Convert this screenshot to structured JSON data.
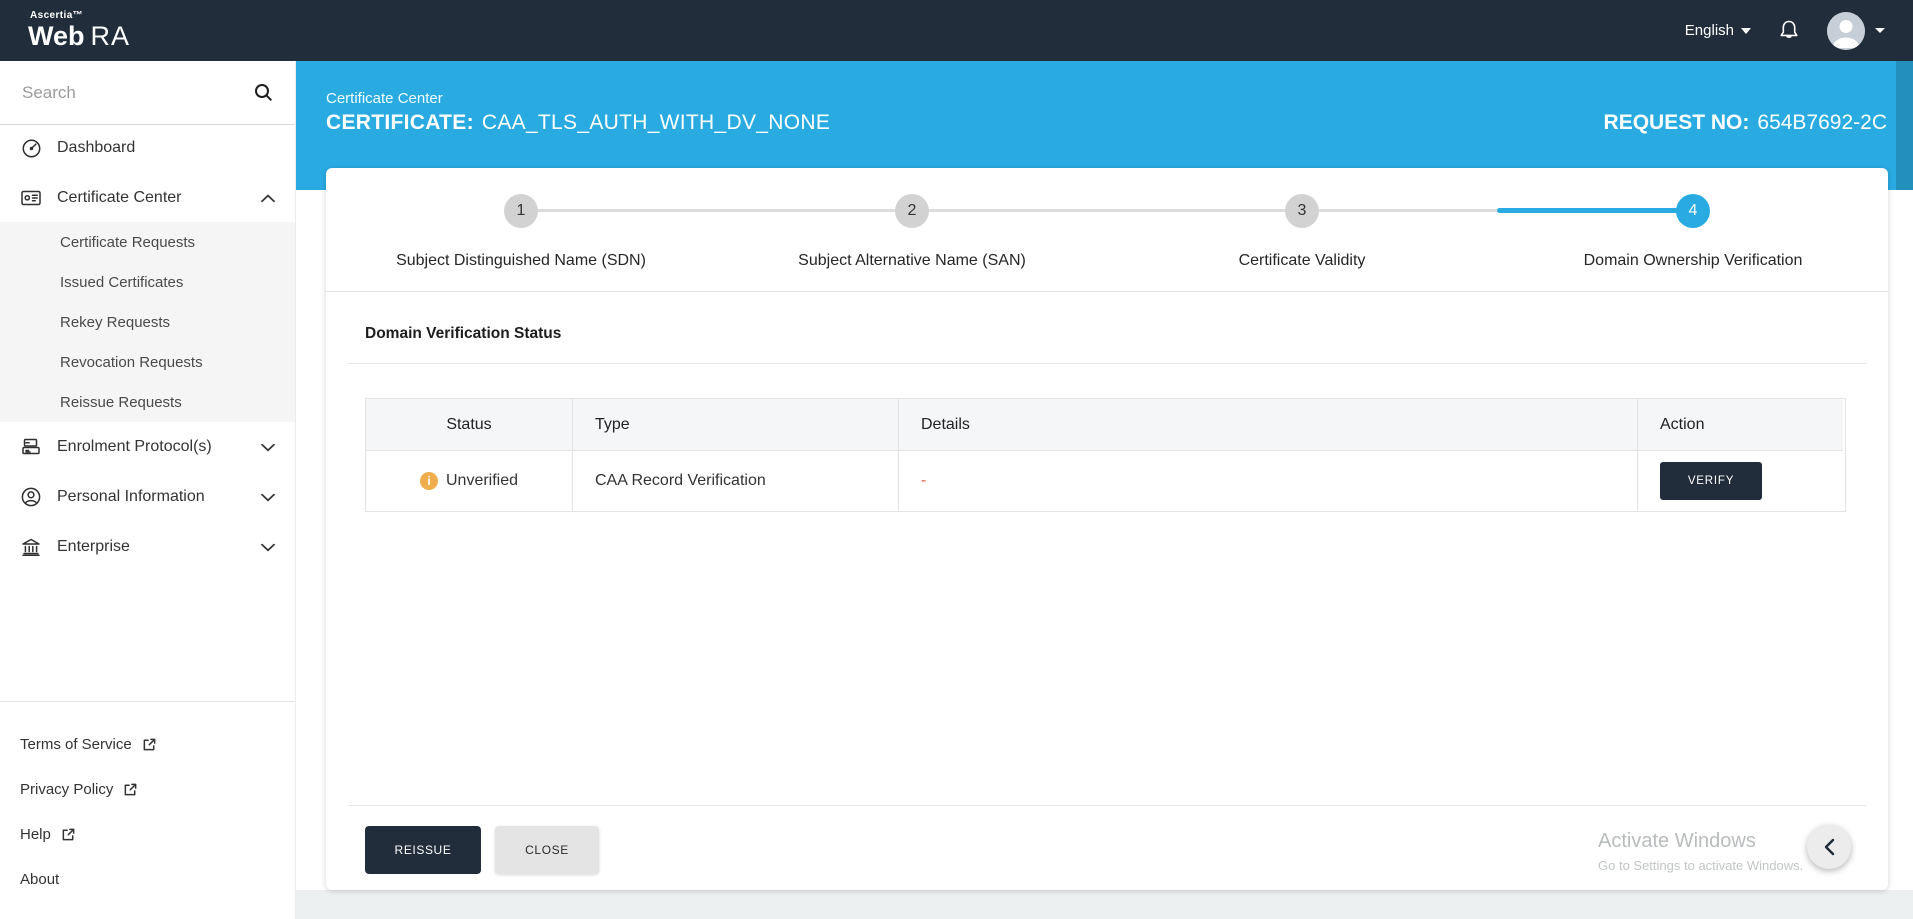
{
  "colors": {
    "accent": "#29abe2",
    "dark_navy": "#222d3b",
    "warning": "#f0ad4e",
    "danger": "#e2574c"
  },
  "navbar": {
    "brand_top": "Ascertia™",
    "brand_web": "Web",
    "brand_ra": "RA",
    "language": "English"
  },
  "sidebar": {
    "search_placeholder": "Search",
    "items": [
      {
        "label": "Dashboard"
      },
      {
        "label": "Certificate Center",
        "expanded": true,
        "children": [
          "Certificate Requests",
          "Issued Certificates",
          "Rekey Requests",
          "Revocation Requests",
          "Reissue Requests"
        ]
      },
      {
        "label": "Enrolment Protocol(s)"
      },
      {
        "label": "Personal Information"
      },
      {
        "label": "Enterprise"
      }
    ],
    "footer": [
      {
        "label": "Terms of Service",
        "external": true
      },
      {
        "label": "Privacy Policy",
        "external": true
      },
      {
        "label": "Help",
        "external": true
      },
      {
        "label": "About",
        "external": false
      }
    ]
  },
  "header": {
    "breadcrumb": "Certificate Center",
    "title_label": "CERTIFICATE:",
    "title_value": "CAA_TLS_AUTH_WITH_DV_NONE",
    "request_label": "REQUEST NO:",
    "request_value": "654B7692-2C"
  },
  "stepper": {
    "steps": [
      {
        "number": "1",
        "label": "Subject Distinguished Name (SDN)"
      },
      {
        "number": "2",
        "label": "Subject Alternative Name (SAN)"
      },
      {
        "number": "3",
        "label": "Certificate Validity"
      },
      {
        "number": "4",
        "label": "Domain Ownership Verification",
        "active": true
      }
    ]
  },
  "content": {
    "section_title": "Domain Verification Status",
    "table": {
      "columns": [
        "Status",
        "Type",
        "Details",
        "Action"
      ],
      "rows": [
        {
          "status": "Unverified",
          "type": "CAA Record Verification",
          "details": "-",
          "action": "VERIFY"
        }
      ]
    },
    "reissue_label": "REISSUE",
    "close_label": "CLOSE"
  },
  "icons": {
    "info_glyph": "i"
  },
  "watermark": {
    "line1": "Activate Windows",
    "line2": "Go to Settings to activate Windows."
  }
}
